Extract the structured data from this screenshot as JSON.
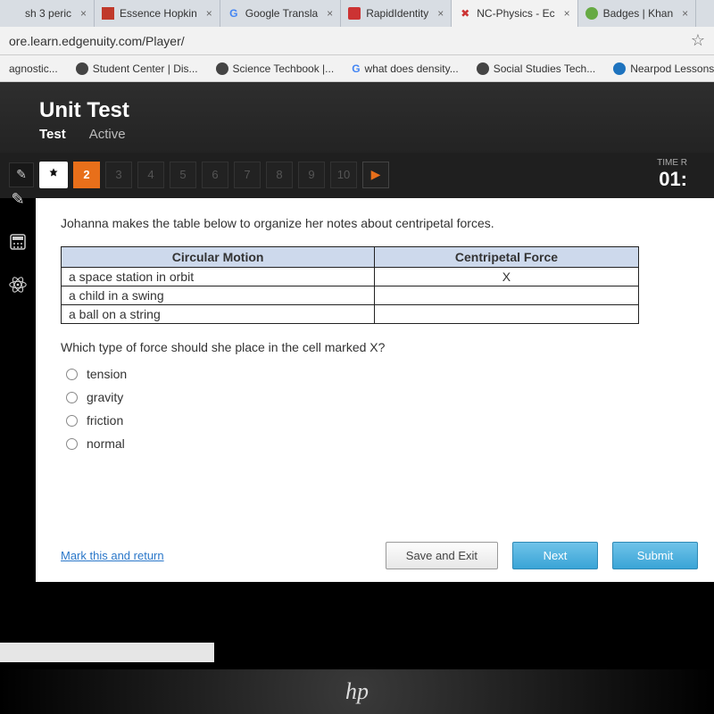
{
  "browser": {
    "tabs": [
      {
        "label": "sh 3 peric",
        "icon": ""
      },
      {
        "label": "Essence Hopkin",
        "icon": "▭"
      },
      {
        "label": "Google Transla",
        "icon": "G"
      },
      {
        "label": "RapidIdentity",
        "icon": "⬤"
      },
      {
        "label": "NC-Physics - Ec",
        "icon": "✖",
        "active": true
      },
      {
        "label": "Badges | Khan",
        "icon": "◆"
      }
    ],
    "url": "ore.learn.edgenuity.com/Player/",
    "bookmarks": [
      {
        "label": "agnostic..."
      },
      {
        "label": "Student Center | Dis..."
      },
      {
        "label": "Science Techbook |..."
      },
      {
        "label": "what does density...",
        "g": true
      },
      {
        "label": "Social Studies Tech..."
      },
      {
        "label": "Nearpod Lessons:..."
      }
    ]
  },
  "test": {
    "title": "Unit Test",
    "tab1": "Test",
    "tab2": "Active",
    "questions": [
      "2",
      "3",
      "4",
      "5",
      "6",
      "7",
      "8",
      "9",
      "10"
    ],
    "current": "2",
    "timer_label": "TIME R",
    "timer_value": "01:",
    "prompt": "Johanna makes the table below to organize her notes about centripetal forces.",
    "table": {
      "headers": [
        "Circular Motion",
        "Centripetal Force"
      ],
      "rows": [
        [
          "a space station in orbit",
          "X"
        ],
        [
          "a child in a swing",
          ""
        ],
        [
          "a ball on a string",
          ""
        ]
      ]
    },
    "follow": "Which type of force should she place in the cell marked X?",
    "options": [
      "tension",
      "gravity",
      "friction",
      "normal"
    ],
    "mark": "Mark this and return",
    "save": "Save and Exit",
    "next": "Next",
    "submit": "Submit"
  },
  "hp": "hp"
}
